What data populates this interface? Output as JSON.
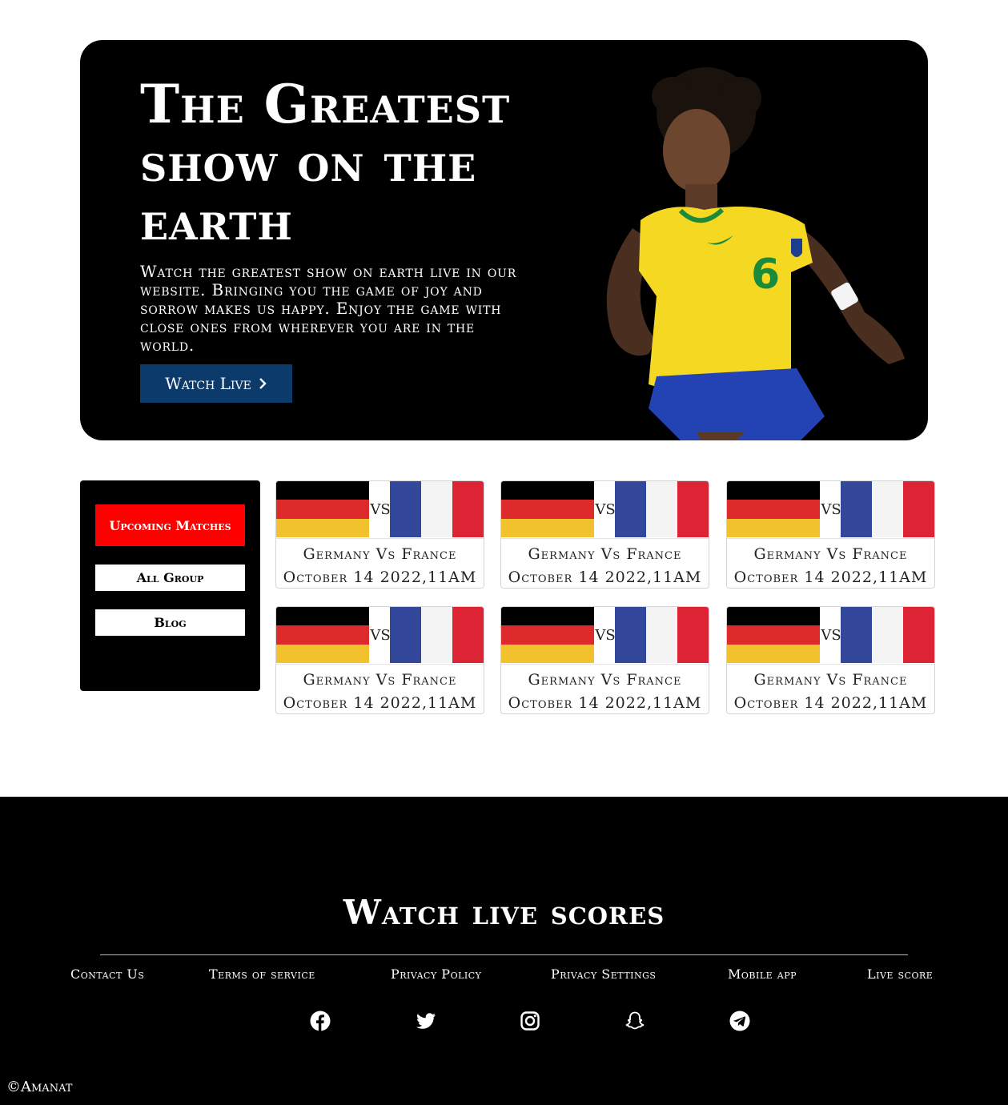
{
  "hero": {
    "title": "The Greatest show on the earth",
    "description": "Watch the greatest show on earth live in our website. Bringing you the game of joy and sorrow makes us happy. Enjoy the game with close ones from wherever you are in the world.",
    "watch_button": "Watch Live"
  },
  "sidebar": {
    "items": [
      {
        "label": "Upcoming Matches"
      },
      {
        "label": "All Group"
      },
      {
        "label": "Blog"
      }
    ]
  },
  "matches": [
    {
      "team1": "Germany",
      "team2": "France",
      "vs": "VS",
      "title": "Germany Vs France",
      "date": "October 14 2022,11AM"
    },
    {
      "team1": "Germany",
      "team2": "France",
      "vs": "VS",
      "title": "Germany Vs France",
      "date": "October 14 2022,11AM"
    },
    {
      "team1": "Germany",
      "team2": "France",
      "vs": "VS",
      "title": "Germany Vs France",
      "date": "October 14 2022,11AM"
    },
    {
      "team1": "Germany",
      "team2": "France",
      "vs": "VS",
      "title": "Germany Vs France",
      "date": "October 14 2022,11AM"
    },
    {
      "team1": "Germany",
      "team2": "France",
      "vs": "VS",
      "title": "Germany Vs France",
      "date": "October 14 2022,11AM"
    },
    {
      "team1": "Germany",
      "team2": "France",
      "vs": "VS",
      "title": "Germany Vs France",
      "date": "October 14 2022,11AM"
    }
  ],
  "footer": {
    "title": "Watch live scores",
    "links": [
      {
        "label": "Contact Us"
      },
      {
        "label": "Terms of service"
      },
      {
        "label": "Privacy Policy"
      },
      {
        "label": "Privacy Settings"
      },
      {
        "label": "Mobile app"
      },
      {
        "label": "Live score"
      }
    ],
    "social": [
      "facebook-icon",
      "twitter-icon",
      "instagram-icon",
      "snapchat-icon",
      "telegram-icon"
    ],
    "copyright": "©Amanat"
  },
  "colors": {
    "accent_red": "#ff0000",
    "button_blue": "#0b3a6b",
    "germany": [
      "#000000",
      "#dd2a2a",
      "#f2c12e"
    ],
    "france": [
      "#33479b",
      "#f4f4f4",
      "#dc2435"
    ]
  }
}
